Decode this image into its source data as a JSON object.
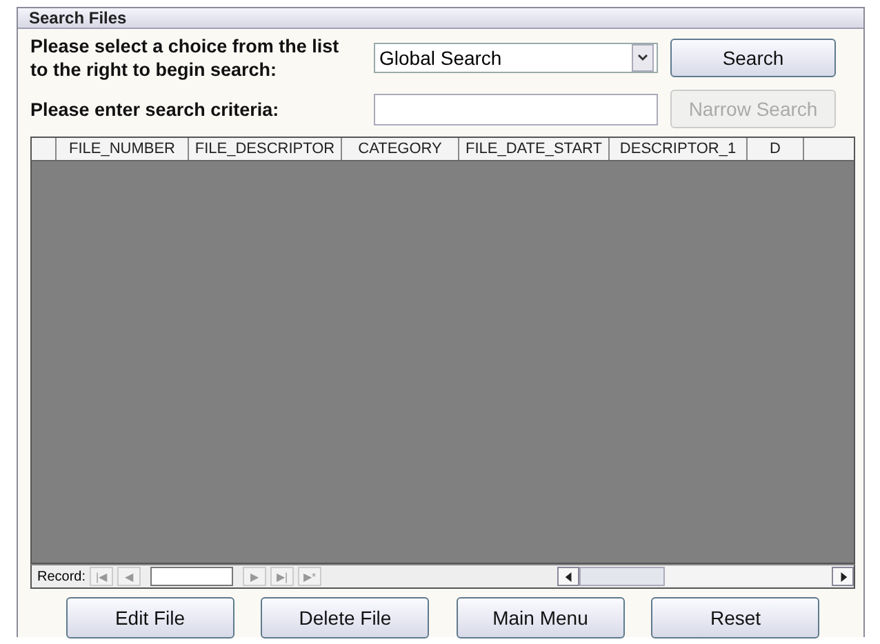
{
  "window": {
    "title": "Search Files"
  },
  "search_prompt": "Please select a choice from the list to the right to begin search:",
  "search_type": {
    "value": "Global Search"
  },
  "search_button": {
    "label": "Search",
    "disabled": false
  },
  "criteria_label": "Please enter search criteria:",
  "narrow_button": {
    "label": "Narrow Search",
    "disabled": true
  },
  "table": {
    "columns": [
      "FILE_NUMBER",
      "FILE_DESCRIPTOR",
      "CATEGORY",
      "FILE_DATE_START",
      "DESCRIPTOR_1",
      "D"
    ]
  },
  "navigator": {
    "label": "Record:",
    "buttons": [
      {
        "symbol": "|◀",
        "disabled": true
      },
      {
        "symbol": "◀",
        "disabled": true
      },
      {
        "symbol": "▶",
        "disabled": true
      },
      {
        "symbol": "▶|",
        "disabled": true
      },
      {
        "symbol": "▶*",
        "disabled": true
      }
    ]
  },
  "buttons": [
    "Edit File",
    "Delete File",
    "Main Menu",
    "Reset"
  ]
}
